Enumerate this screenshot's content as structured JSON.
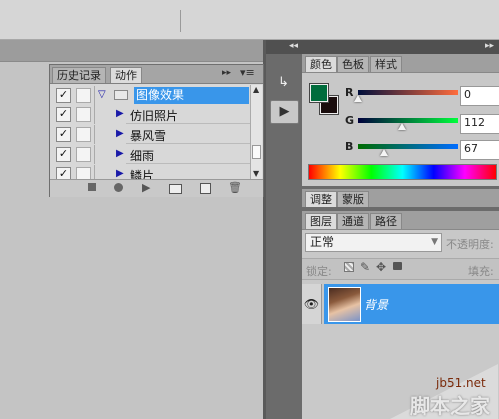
{
  "colors": {
    "foreground": "#006c3c",
    "background": "#1a0d0d",
    "selection": "#3996ea",
    "panel_dark": "#505050"
  },
  "actions_panel": {
    "tabs": [
      "历史记录",
      "动作"
    ],
    "active_tab": "动作",
    "group_name": "图像效果",
    "items": [
      {
        "label": "仿旧照片"
      },
      {
        "label": "暴风雪"
      },
      {
        "label": "细雨"
      },
      {
        "label": "鳞片"
      }
    ],
    "footer_icons": [
      "stop-icon",
      "record-icon",
      "play-icon",
      "new-set-icon",
      "new-action-icon",
      "delete-icon"
    ]
  },
  "color_panel": {
    "tabs": [
      "颜色",
      "色板",
      "样式"
    ],
    "active_tab": "颜色",
    "channels": [
      {
        "label": "R",
        "value": "0",
        "fraction": 0.0,
        "gradient": "linear-gradient(to right,#000f3c,#ff6c3c)"
      },
      {
        "label": "G",
        "value": "112",
        "fraction": 0.44,
        "gradient": "linear-gradient(to right,#00003c,#00ff3c)"
      },
      {
        "label": "B",
        "value": "67",
        "fraction": 0.26,
        "gradient": "linear-gradient(to right,#006c00,#006cff)"
      }
    ]
  },
  "adjust_panel": {
    "tabs": [
      "调整",
      "蒙版"
    ],
    "active_tab": "调整"
  },
  "layers_panel": {
    "tabs": [
      "图层",
      "通道",
      "路径"
    ],
    "active_tab": "图层",
    "blend_mode": "正常",
    "opacity_label": "不透明度:",
    "lock_label": "锁定:",
    "fill_label": "填充:",
    "layer_name": "背景"
  },
  "watermark": {
    "site": "jb51.net",
    "brand": "脚本之家"
  }
}
